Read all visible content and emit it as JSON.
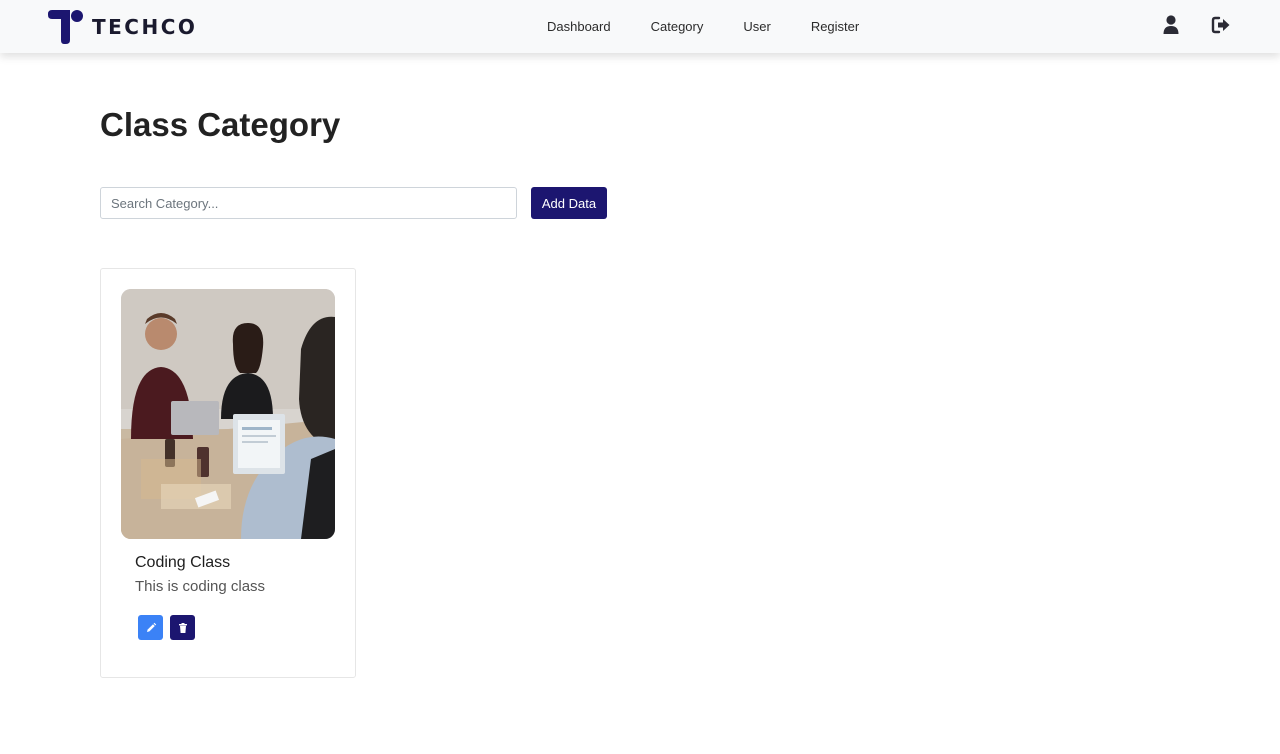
{
  "brand": {
    "name": "TECHCO"
  },
  "nav": {
    "links": [
      {
        "label": "Dashboard"
      },
      {
        "label": "Category"
      },
      {
        "label": "User"
      },
      {
        "label": "Register"
      }
    ]
  },
  "page": {
    "title": "Class Category"
  },
  "search": {
    "placeholder": "Search Category...",
    "value": ""
  },
  "toolbar": {
    "add_label": "Add Data"
  },
  "categories": [
    {
      "title": "Coding Class",
      "description": "This is coding class"
    }
  ],
  "colors": {
    "primary": "#1c1670",
    "edit": "#3b82f6",
    "navbar_bg": "#f8f9fa"
  },
  "icons": {
    "user": "user-icon",
    "logout": "logout-icon",
    "edit": "pencil-icon",
    "delete": "trash-icon"
  }
}
